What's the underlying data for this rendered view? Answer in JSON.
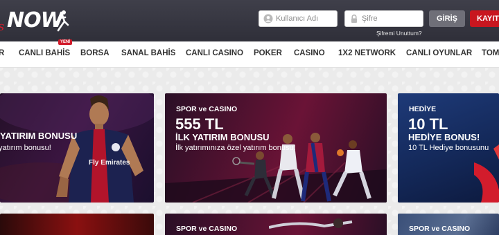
{
  "brand": {
    "logo_text": "NOW",
    "logo_prefix": "s"
  },
  "login": {
    "username_placeholder": "Kullanıcı Adı",
    "password_placeholder": "Şifre",
    "forgot_label": "Şifremi Unuttum?",
    "login_label": "GİRİŞ",
    "register_label": "KAYIT"
  },
  "nav": {
    "items": [
      {
        "label": "R"
      },
      {
        "label": "CANLI BAHİS"
      },
      {
        "label": "BORSA"
      },
      {
        "label": "SANAL BAHİS"
      },
      {
        "label": "CANLI CASINO"
      },
      {
        "label": "POKER"
      },
      {
        "label": "CASINO"
      },
      {
        "label": "1X2 NETWORK"
      },
      {
        "label": "CANLI OYUNLAR"
      },
      {
        "label": "TOM"
      }
    ],
    "new_badge": "YENİ"
  },
  "promos": [
    {
      "title": "YATIRIM BONUSU",
      "subtitle": "yatırım bonusu!",
      "jersey_text": "Fly Emirates"
    },
    {
      "category": "SPOR ve CASINO",
      "headline": "555 TL",
      "title": "İLK YATIRIM BONUSU",
      "subtitle": "İlk yatırımınıza özel yatırım bonusu!"
    },
    {
      "category": "HEDİYE",
      "headline": "10 TL",
      "title": "HEDİYE BONUS!",
      "subtitle": "10 TL Hediye bonusunu"
    }
  ],
  "promos_row2": [
    {
      "category": ""
    },
    {
      "category": "SPOR ve CASINO"
    },
    {
      "category": "SPOR ve CASINO"
    }
  ],
  "colors": {
    "header_bg": "#35353f",
    "accent_red": "#c8161f",
    "nav_bg": "#ffffff",
    "card_dark_blue": "#172a5a",
    "card_crimson": "#5a1230"
  }
}
